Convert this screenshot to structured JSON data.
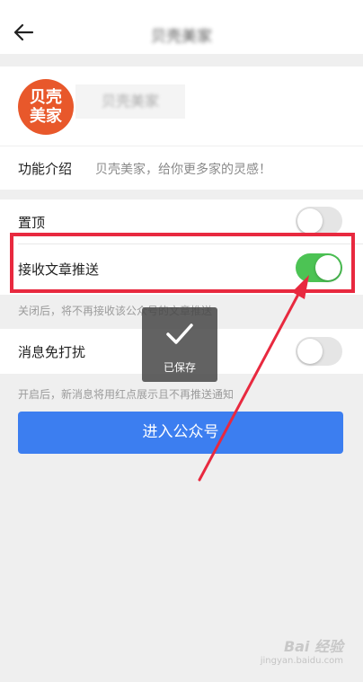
{
  "header": {
    "title": "贝壳美家"
  },
  "profile": {
    "logo_text": "贝壳美家",
    "name": "贝壳美家"
  },
  "intro": {
    "label": "功能介绍",
    "value": "贝壳美家，给你更多家的灵感！"
  },
  "settings": {
    "pin": {
      "label": "置顶",
      "enabled": false
    },
    "receive_push": {
      "label": "接收文章推送",
      "enabled": true,
      "note": "关闭后，将不再接收该公众号的文章推送"
    },
    "mute": {
      "label": "消息免打扰",
      "enabled": false,
      "note": "开启后，新消息将用红点展示且不再推送通知"
    }
  },
  "enter_button": {
    "label": "进入公众号"
  },
  "toast": {
    "text": "已保存"
  },
  "watermark": {
    "brand": "Bai 经验",
    "url": "jingyan.baidu.com"
  },
  "colors": {
    "accent_blue": "#3c7ef0",
    "toggle_on": "#4cc354",
    "highlight_red": "#e8293f",
    "logo_orange": "#e8582b"
  }
}
